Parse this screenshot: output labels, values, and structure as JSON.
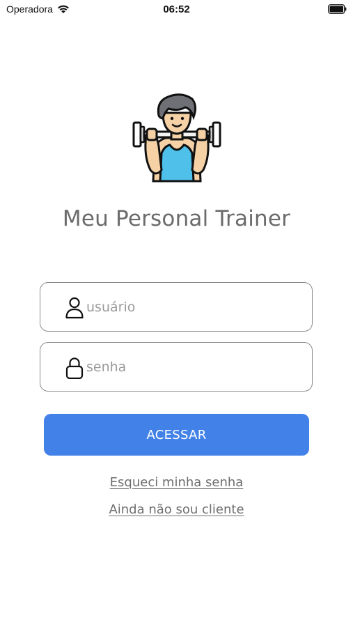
{
  "status_bar": {
    "carrier": "Operadora",
    "time": "06:52"
  },
  "app": {
    "title": "Meu Personal Trainer"
  },
  "login": {
    "username_placeholder": "usuário",
    "username_value": "",
    "password_placeholder": "senha",
    "password_value": "",
    "access_label": "ACESSAR",
    "forgot_label": "Esqueci minha senha",
    "signup_label": "Ainda não sou cliente"
  },
  "icons": {
    "wifi": "wifi-icon",
    "battery": "battery-icon",
    "mascot": "weightlifter-icon",
    "user": "user-icon",
    "lock": "lock-icon"
  },
  "colors": {
    "accent": "#4282e8",
    "title": "#6b6b6b",
    "border": "#8a8a8a",
    "placeholder": "#9a9a9a"
  }
}
